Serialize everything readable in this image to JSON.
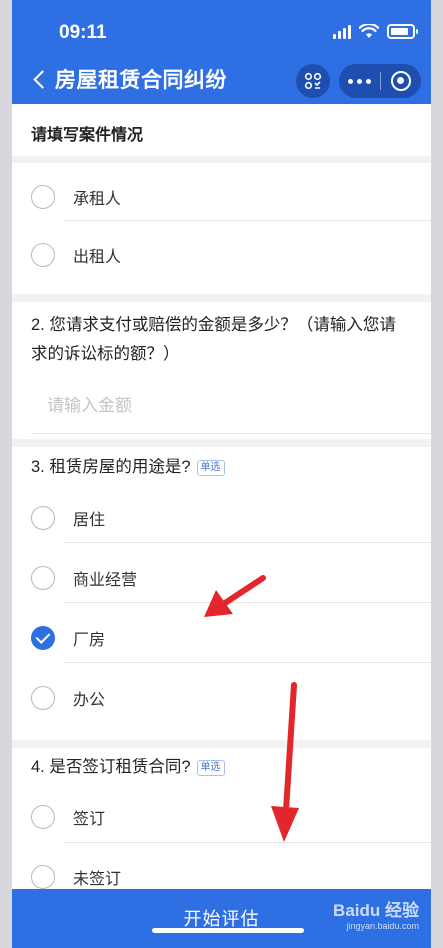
{
  "status_bar": {
    "time": "09:11"
  },
  "nav": {
    "title": "房屋租赁合同纠纷"
  },
  "section": {
    "title": "请填写案件情况"
  },
  "q1": {
    "options": [
      {
        "label": "承租人",
        "checked": false
      },
      {
        "label": "出租人",
        "checked": false
      }
    ]
  },
  "q2": {
    "title_line1": "2. 您请求支付或赔偿的金额是多少？（请输入您请",
    "title_line2": "求的诉讼标的额？）",
    "placeholder": "请输入金额"
  },
  "q3": {
    "title": "3. 租赁房屋的用途是?",
    "badge": "单选",
    "options": [
      {
        "label": "居住",
        "checked": false
      },
      {
        "label": "商业经营",
        "checked": false
      },
      {
        "label": "厂房",
        "checked": true
      },
      {
        "label": "办公",
        "checked": false
      }
    ]
  },
  "q4": {
    "title": "4. 是否签订租赁合同?",
    "badge": "单选",
    "options": [
      {
        "label": "签订",
        "checked": false
      },
      {
        "label": "未签订",
        "checked": false
      }
    ]
  },
  "footer": {
    "button_label": "开始评估"
  },
  "watermark": {
    "brand": "Baidu 经验",
    "url": "jingyan.baidu.com"
  },
  "colors": {
    "primary": "#2f6fe4",
    "annotation_arrow": "#e3262b"
  }
}
